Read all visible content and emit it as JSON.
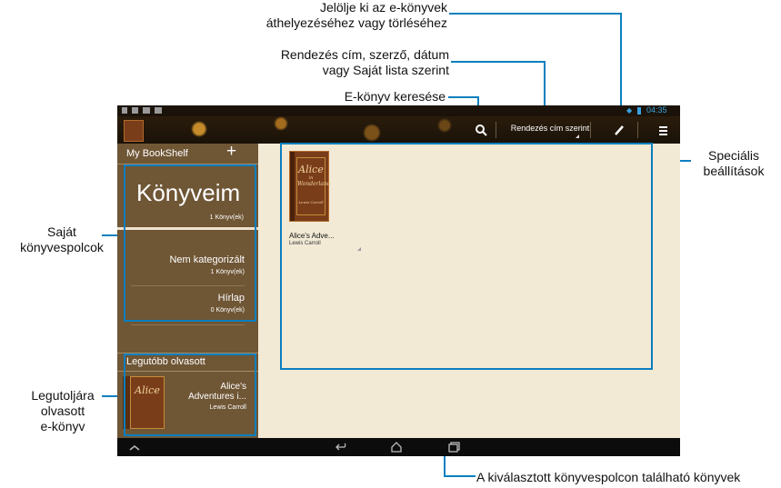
{
  "callouts": {
    "select_line1": "Jelölje ki az e-könyvek",
    "select_line2": "áthelyezéséhez vagy törléséhez",
    "sort_line1": "Rendezés cím, szerző, dátum",
    "sort_line2": "vagy Saját lista szerint",
    "search": "E-könyv keresése",
    "special_line1": "Speciális",
    "special_line2": "beállítások",
    "shelves_line1": "Saját",
    "shelves_line2": "könyvespolcok",
    "recent_line1": "Legutoljára",
    "recent_line2": "olvasott",
    "recent_line3": "e-könyv",
    "books_in_shelf": "A kiválasztott könyvespolcon található könyvek"
  },
  "status": {
    "time": "04:35"
  },
  "actionbar": {
    "sort_label": "Rendezés cím szerint"
  },
  "sidebar": {
    "header": "My BookShelf",
    "add_symbol": "+",
    "main_shelf": {
      "title": "Könyveim",
      "count": "1 Könyv(ek)",
      "progress": 1.0
    },
    "shelves": [
      {
        "name": "Nem kategorizált",
        "count": "1 Könyv(ek)"
      },
      {
        "name": "Hírlap",
        "count": "0 Könyv(ek)"
      }
    ],
    "recent_header": "Legutóbb olvasott",
    "recent_book": {
      "title_line1": "Alice's",
      "title_line2": "Adventures i...",
      "author": "Lewis Carroll"
    }
  },
  "book": {
    "cover_title": "Alice",
    "cover_sub1": "in",
    "cover_sub2": "Wonderland",
    "cover_author": "Lewis Carroll",
    "title": "Alice's Adve...",
    "author": "Lewis Carroll"
  },
  "colors": {
    "accent": "#0a7fbf",
    "sidebar": "#6f5635",
    "content_bg": "#f2ead5"
  },
  "icons": [
    "search-icon",
    "edit-icon",
    "menu-icon",
    "back-icon",
    "home-icon",
    "recent-apps-icon",
    "collapse-icon"
  ]
}
